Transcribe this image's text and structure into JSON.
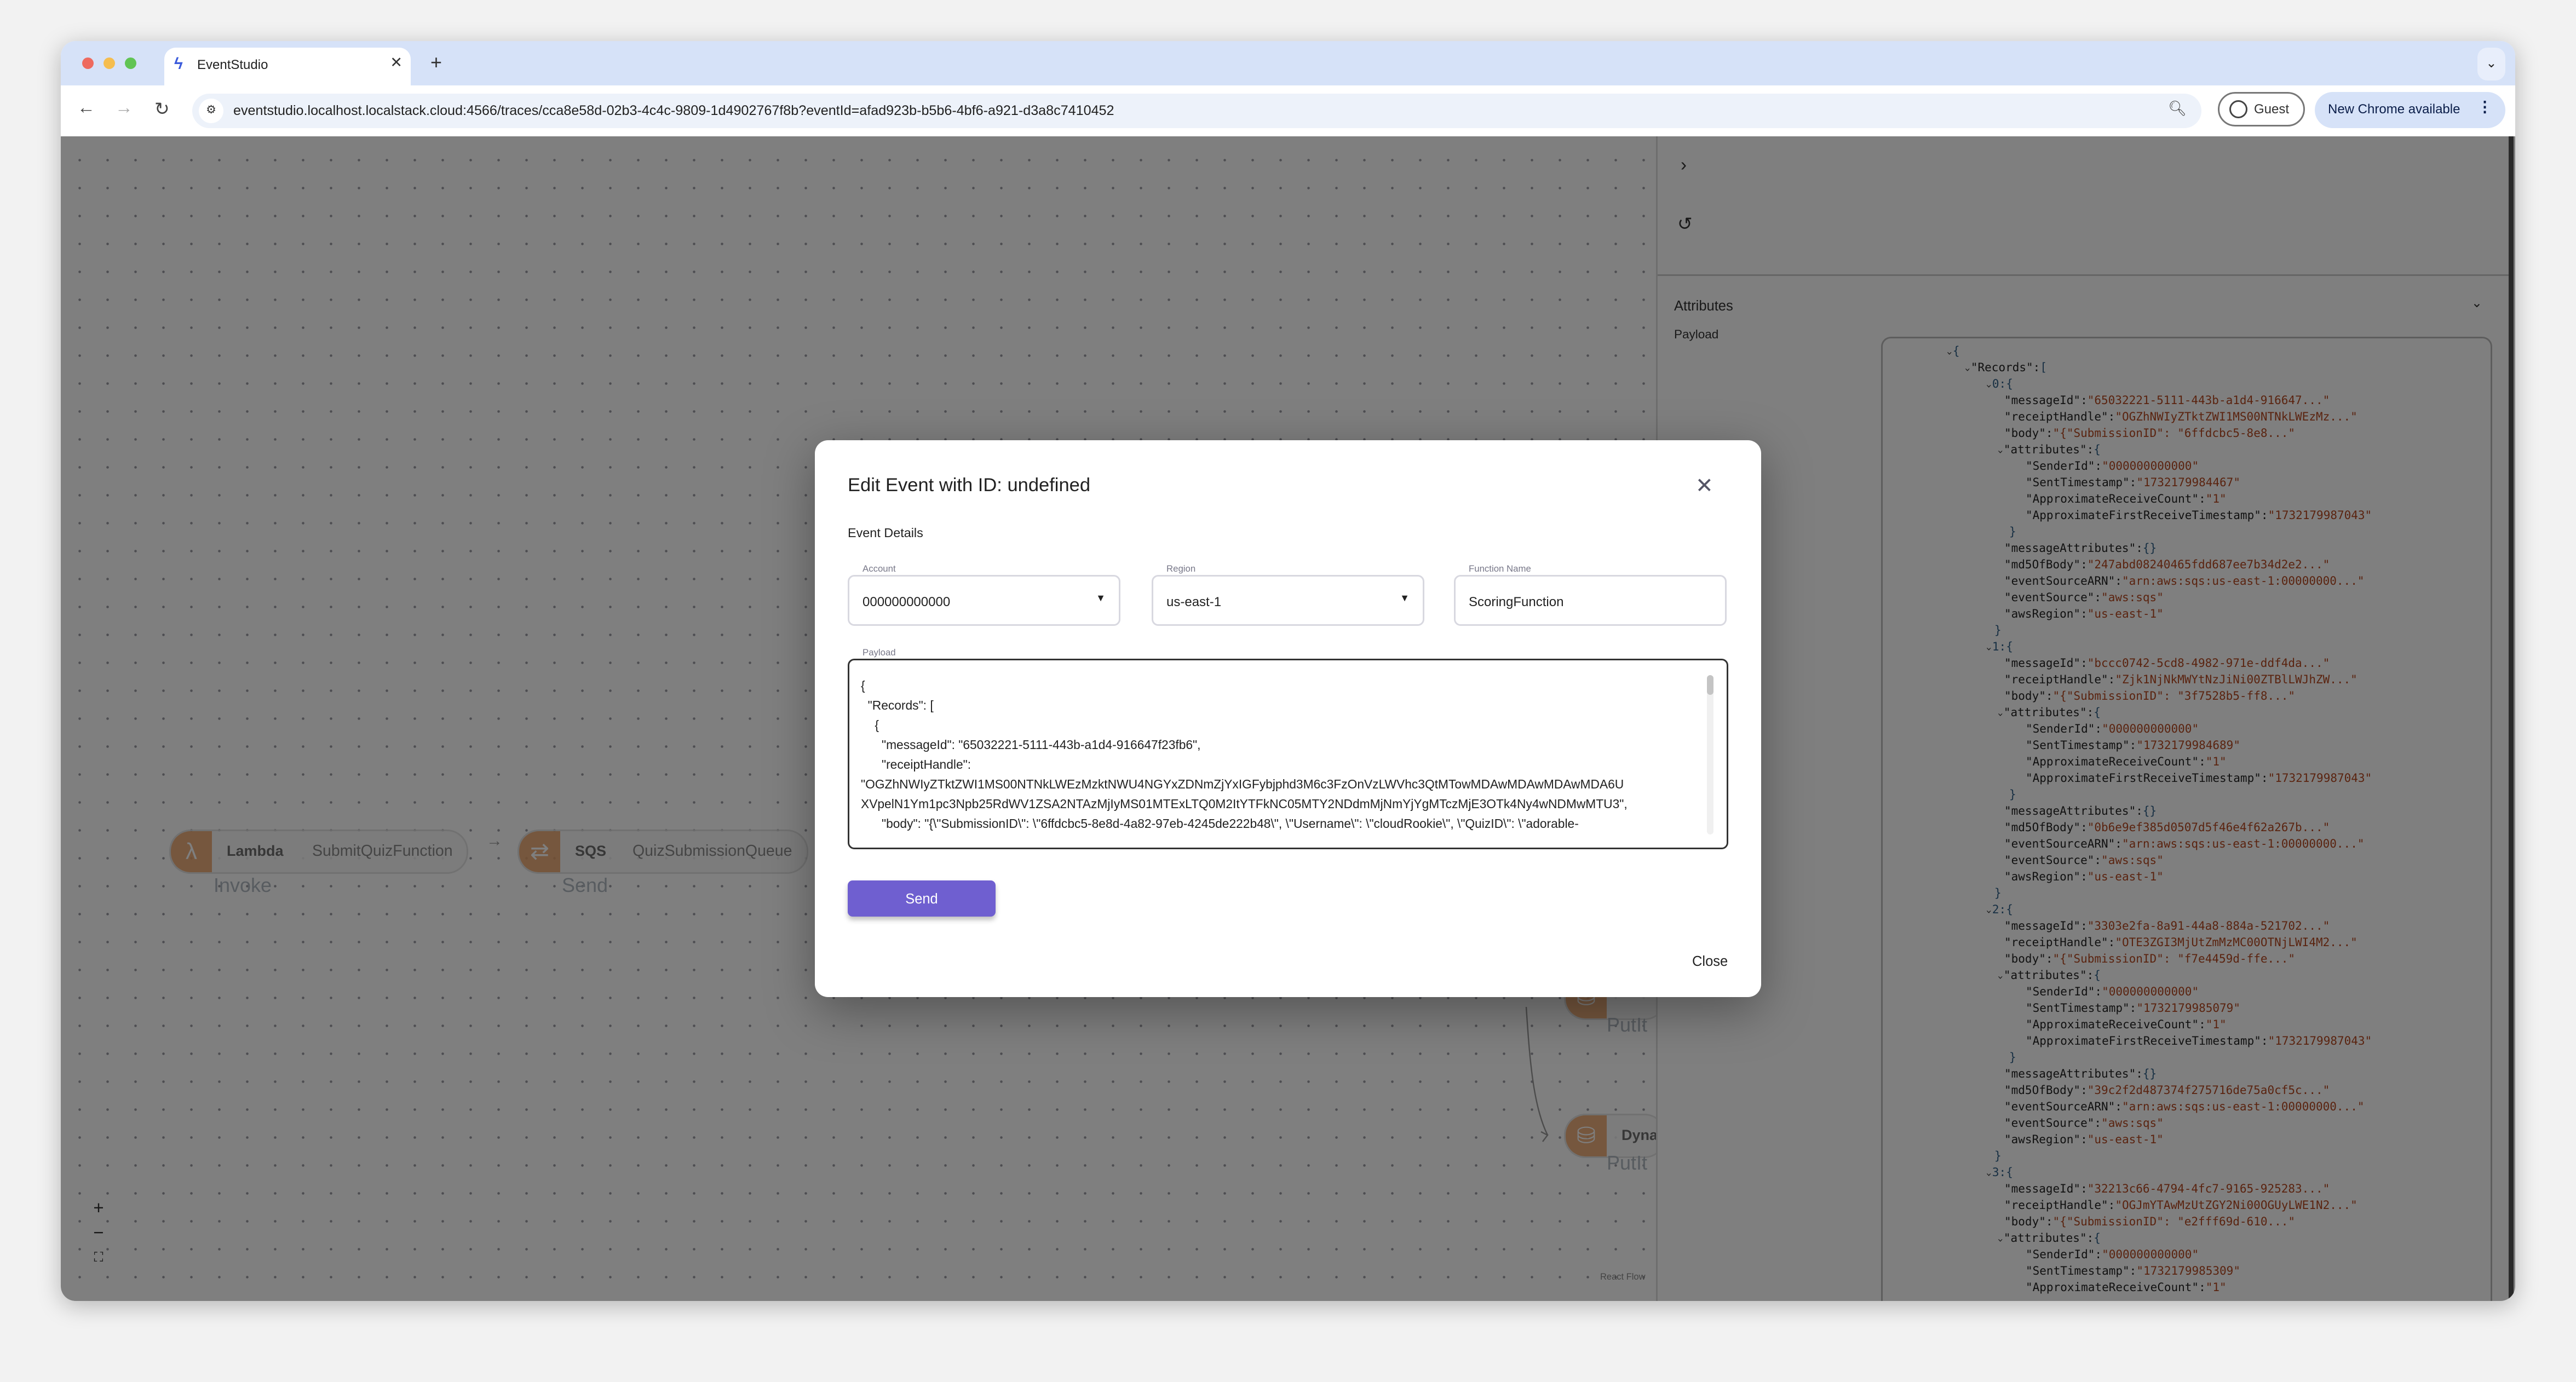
{
  "browser": {
    "tab_title": "EventStudio",
    "new_tab": "+",
    "url": "eventstudio.localhost.localstack.cloud:4566/traces/cca8e58d-02b3-4c4c-9809-1d4902767f8b?eventId=afad923b-b5b6-4bf6-a921-d3a8c7410452",
    "profile_label": "Guest",
    "update_label": "New Chrome available",
    "traffic_lights": [
      "#ee6a5f",
      "#f5bd4f",
      "#61c454"
    ]
  },
  "flow": {
    "nodes": [
      {
        "service": "Lambda",
        "resource": "SubmitQuizFunction",
        "operation": "Invoke",
        "icon": "lambda-icon"
      },
      {
        "service": "SQS",
        "resource": "QuizSubmissionQueue",
        "operation": "Send",
        "icon": "sqs-icon"
      },
      {
        "service": "",
        "resource": "",
        "operation": "PutIt",
        "icon": "dynamodb-icon"
      },
      {
        "service": "Dyna",
        "resource": "",
        "operation": "PutIt",
        "icon": "dynamodb-icon"
      }
    ],
    "controls": {
      "zoom_in": "+",
      "zoom_out": "−",
      "fit": "⛶"
    },
    "attribution": "React Flow",
    "node_accent": "#e9a066"
  },
  "detail_panel": {
    "attributes_label": "Attributes",
    "payload_label": "Payload",
    "payload_tree": {
      "root_key": "Records",
      "records": [
        {
          "index": "0",
          "messageId": "65032221-5111-443b-a1d4-916647...",
          "receiptHandle": "OGZhNWIyZTktZWI1MS00NTNkLWEzMz...",
          "body": "{\"SubmissionID\": \"6ffdcbc5-8e8...",
          "attributes": {
            "SenderId": "000000000000",
            "SentTimestamp": "1732179984467",
            "ApproximateReceiveCount": "1",
            "ApproximateFirstReceiveTimestamp": "1732179987043"
          },
          "messageAttributes": "{}",
          "md5OfBody": "247abd08240465fdd687ee7b34d2e2...",
          "eventSourceARN": "arn:aws:sqs:us-east-1:00000000...",
          "eventSource": "aws:sqs",
          "awsRegion": "us-east-1"
        },
        {
          "index": "1",
          "messageId": "bccc0742-5cd8-4982-971e-ddf4da...",
          "receiptHandle": "Zjk1NjNkMWYtNzJiNi00ZTBlLWJhZW...",
          "body": "{\"SubmissionID\": \"3f7528b5-ff8...",
          "attributes": {
            "SenderId": "000000000000",
            "SentTimestamp": "1732179984689",
            "ApproximateReceiveCount": "1",
            "ApproximateFirstReceiveTimestamp": "1732179987043"
          },
          "messageAttributes": "{}",
          "md5OfBody": "0b6e9ef385d0507d5f46e4f62a267b...",
          "eventSourceARN": "arn:aws:sqs:us-east-1:00000000...",
          "eventSource": "aws:sqs",
          "awsRegion": "us-east-1"
        },
        {
          "index": "2",
          "messageId": "3303e2fa-8a91-44a8-884a-521702...",
          "receiptHandle": "OTE3ZGI3MjUtZmMzMC00OTNjLWI4M2...",
          "body": "{\"SubmissionID\": \"f7e4459d-ffe...",
          "attributes": {
            "SenderId": "000000000000",
            "SentTimestamp": "1732179985079",
            "ApproximateReceiveCount": "1",
            "ApproximateFirstReceiveTimestamp": "1732179987043"
          },
          "messageAttributes": "{}",
          "md5OfBody": "39c2f2d487374f275716de75a0cf5c...",
          "eventSourceARN": "arn:aws:sqs:us-east-1:00000000...",
          "eventSource": "aws:sqs",
          "awsRegion": "us-east-1"
        },
        {
          "index": "3",
          "messageId": "32213c66-4794-4fc7-9165-925283...",
          "receiptHandle": "OGJmYTAwMzUtZGY2Ni00OGUyLWE1N2...",
          "body": "{\"SubmissionID\": \"e2fff69d-610...",
          "attributes": {
            "SenderId": "000000000000",
            "SentTimestamp": "1732179985309",
            "ApproximateReceiveCount": "1"
          }
        }
      ]
    }
  },
  "modal": {
    "title": "Edit Event with ID: undefined",
    "section_label": "Event Details",
    "account": {
      "label": "Account",
      "value": "000000000000"
    },
    "region": {
      "label": "Region",
      "value": "us-east-1"
    },
    "function_name": {
      "label": "Function Name",
      "value": "ScoringFunction"
    },
    "payload": {
      "label": "Payload",
      "lines": [
        "{",
        "  \"Records\": [",
        "    {",
        "      \"messageId\": \"65032221-5111-443b-a1d4-916647f23fb6\",",
        "      \"receiptHandle\":",
        "\"OGZhNWIyZTktZWI1MS00NTNkLWEzMzktNWU4NGYxZDNmZjYxIGFybjphd3M6c3FzOnVzLWVhc3QtMTowMDAwMDAwMDAwMDA6U",
        "XVpelN1Ym1pc3Npb25RdWV1ZSA2NTAzMjIyMS01MTExLTQ0M2ItYTFkNC05MTY2NDdmMjNmYjYgMTczMjE3OTk4Ny4wNDMwMTU3\",",
        "      \"body\": \"{\\\"SubmissionID\\\": \\\"6ffdcbc5-8e8d-4a82-97eb-4245de222b48\\\", \\\"Username\\\": \\\"cloudRookie\\\", \\\"QuizID\\\": \\\"adorable-"
      ]
    },
    "send_label": "Send",
    "close_label": "Close",
    "accent": "#6f5fd0"
  }
}
